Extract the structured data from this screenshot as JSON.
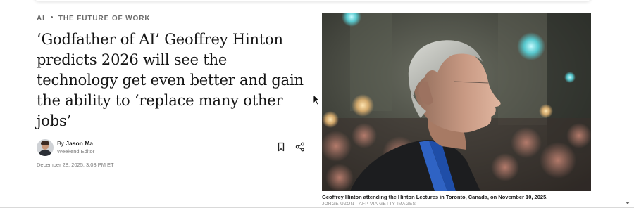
{
  "breadcrumb": {
    "section": "AI",
    "topic": "THE FUTURE OF WORK"
  },
  "article": {
    "headline": "‘Godfather of AI’ Geoffrey Hinton predicts 2026 will see the technology get even better and gain the ability to ‘replace many other jobs’",
    "author_prefix": "By",
    "author_name": "Jason Ma",
    "author_role": "Weekend Editor",
    "date": "December 28, 2025, 3:03 PM ET"
  },
  "actions": {
    "bookmark_icon": "bookmark-icon",
    "share_icon": "share-icon"
  },
  "hero_image": {
    "caption": "Geoffrey Hinton attending the Hinton Lectures in Toronto, Canada, on November 10, 2025.",
    "credit": "JORGE UZON—AFP VIA GETTY IMAGES"
  },
  "colors": {
    "text": "#151515",
    "muted": "#7a7a7a",
    "shirt_blue": "#2f63c4"
  }
}
